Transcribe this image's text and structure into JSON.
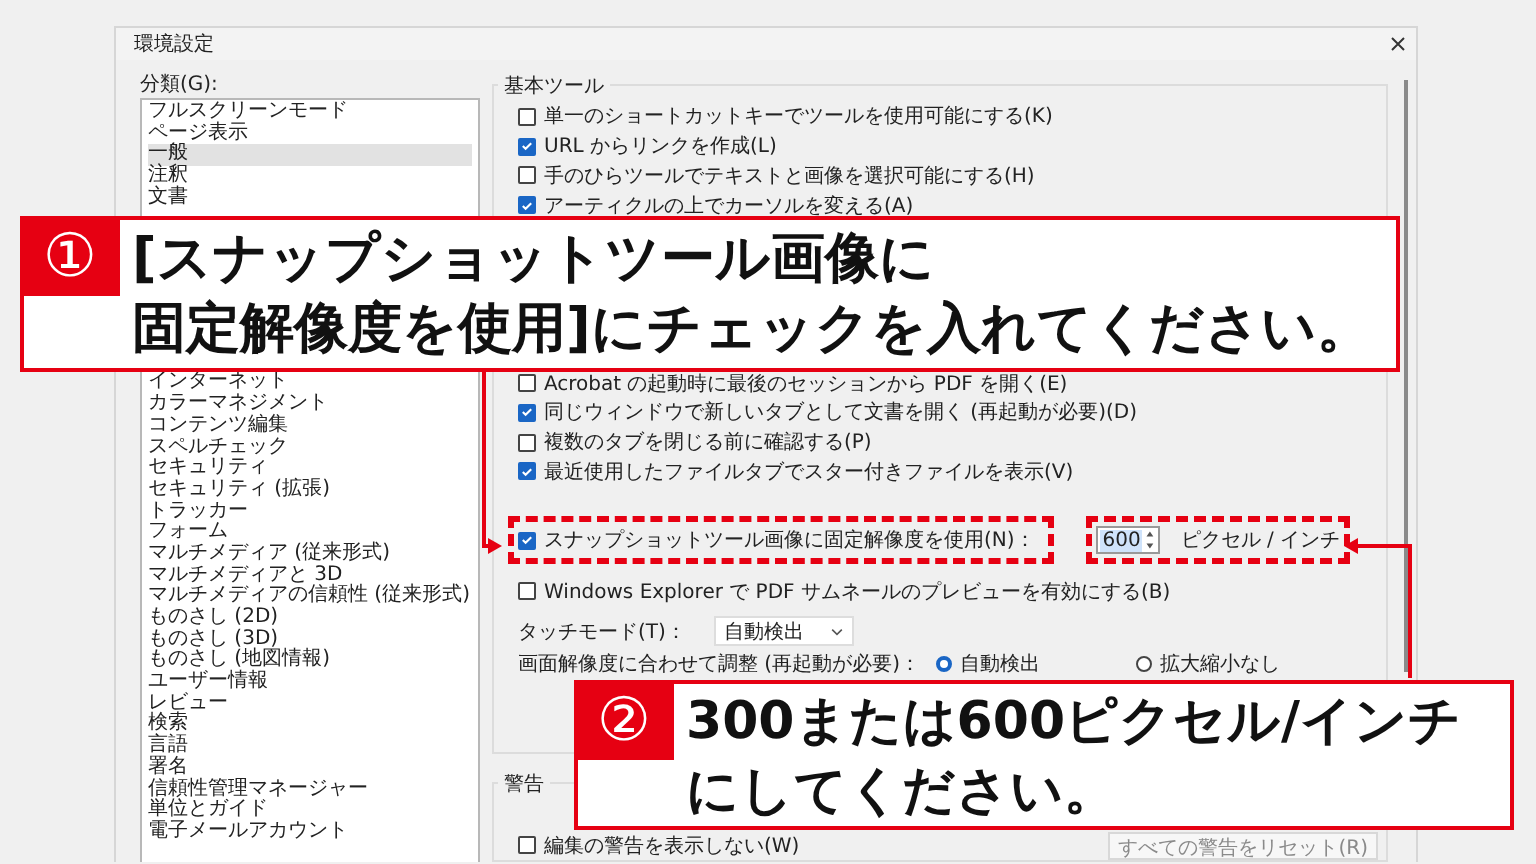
{
  "window": {
    "title": "環境設定"
  },
  "categories": {
    "label": "分類(G):",
    "items": [
      {
        "label": "フルスクリーンモード",
        "selected": false
      },
      {
        "label": "ページ表示",
        "selected": false
      },
      {
        "label": "一般",
        "selected": true
      },
      {
        "label": "注釈",
        "selected": false
      },
      {
        "label": "文書",
        "selected": false
      },
      {
        "label": "インターネット",
        "selected": false
      },
      {
        "label": "カラーマネジメント",
        "selected": false
      },
      {
        "label": "コンテンツ編集",
        "selected": false
      },
      {
        "label": "スペルチェック",
        "selected": false
      },
      {
        "label": "セキュリティ",
        "selected": false
      },
      {
        "label": "セキュリティ (拡張)",
        "selected": false
      },
      {
        "label": "トラッカー",
        "selected": false
      },
      {
        "label": "フォーム",
        "selected": false
      },
      {
        "label": "マルチメディア (従来形式)",
        "selected": false
      },
      {
        "label": "マルチメディアと 3D",
        "selected": false
      },
      {
        "label": "マルチメディアの信頼性 (従来形式)",
        "selected": false
      },
      {
        "label": "ものさし (2D)",
        "selected": false
      },
      {
        "label": "ものさし (3D)",
        "selected": false
      },
      {
        "label": "ものさし (地図情報)",
        "selected": false
      },
      {
        "label": "ユーザー情報",
        "selected": false
      },
      {
        "label": "レビュー",
        "selected": false
      },
      {
        "label": "検索",
        "selected": false
      },
      {
        "label": "言語",
        "selected": false
      },
      {
        "label": "署名",
        "selected": false
      },
      {
        "label": "信頼性管理マネージャー",
        "selected": false
      },
      {
        "label": "単位とガイド",
        "selected": false
      },
      {
        "label": "電子メールアカウント",
        "selected": false
      }
    ]
  },
  "basic_tools": {
    "title": "基本ツール",
    "options_top": [
      {
        "label": "単一のショートカットキーでツールを使用可能にする(K)",
        "checked": false
      },
      {
        "label": "URL からリンクを作成(L)",
        "checked": true
      },
      {
        "label": "手のひらツールでテキストと画像を選択可能にする(H)",
        "checked": false
      },
      {
        "label": "アーティクルの上でカーソルを変える(A)",
        "checked": true
      }
    ],
    "options_bottom": [
      {
        "label": "Acrobat の起動時に最後のセッションから PDF を開く(E)",
        "checked": false
      },
      {
        "label": "同じウィンドウで新しいタブとして文書を開く (再起動が必要)(D)",
        "checked": true
      },
      {
        "label": "複数のタブを閉じる前に確認する(P)",
        "checked": false
      },
      {
        "label": "最近使用したファイルタブでスター付きファイルを表示(V)",
        "checked": true
      }
    ],
    "snapshot": {
      "label": "スナップショットツール画像に固定解像度を使用(N)：",
      "checked": true,
      "value": "600",
      "unit": "ピクセル / インチ"
    },
    "explorer": {
      "label": "Windows Explorer で PDF サムネールのプレビューを有効にする(B)",
      "checked": false
    },
    "touch_mode": {
      "label": "タッチモード(T)：",
      "value": "自動検出"
    },
    "scaling": {
      "label": "画面解像度に合わせて調整 (再起動が必要)：",
      "options": [
        {
          "label": "自動検出",
          "selected": true
        },
        {
          "label": "拡大縮小なし",
          "selected": false
        }
      ]
    }
  },
  "warnings": {
    "title": "警告",
    "options": [
      {
        "label": "編集の警告を表示しない(W)",
        "checked": false
      }
    ],
    "reset_button": {
      "label": "すべての警告をリセット(R)",
      "disabled": true
    }
  },
  "callouts": [
    {
      "number": "①",
      "lines": [
        "[スナップショットツール画像に",
        "固定解像度を使用]にチェックを入れてください。"
      ]
    },
    {
      "number": "②",
      "lines": [
        "300または600ピクセル/インチ",
        "にしてください。"
      ]
    }
  ]
}
